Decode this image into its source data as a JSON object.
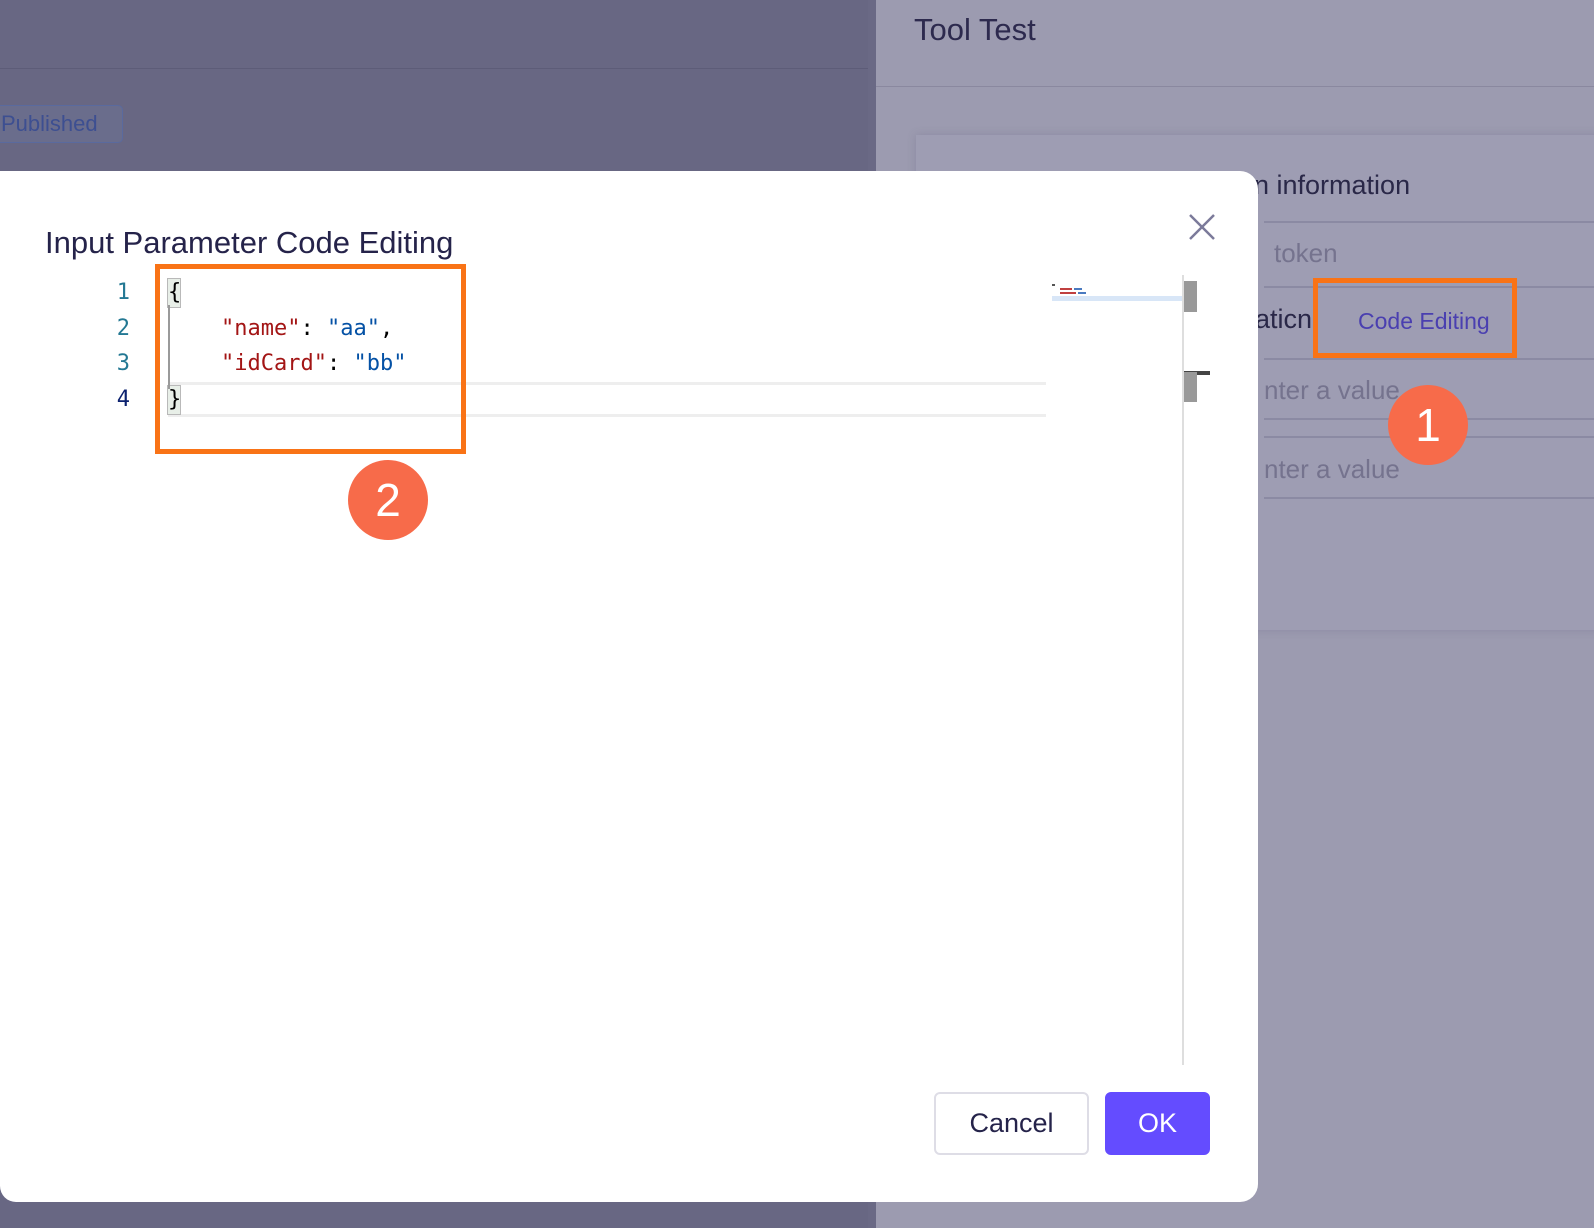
{
  "background": {
    "status_badge": "Published",
    "drawer": {
      "title": "Tool Test",
      "section_heading_partial": "n information",
      "token_field_partial": "token",
      "config_label_partial": "ratic",
      "config_label_tail": "n",
      "code_editing_link": "Code Editing",
      "value_field_1_placeholder_partial": "nter a value",
      "value_field_2_placeholder_partial": "nter a value"
    }
  },
  "annotations": {
    "step_1": "1",
    "step_2": "2",
    "highlight_color": "#f97316",
    "badge_color": "#f76b4a"
  },
  "modal": {
    "title": "Input Parameter Code Editing",
    "editor": {
      "language": "json",
      "line_numbers": [
        "1",
        "2",
        "3",
        "4"
      ],
      "active_line": 4,
      "lines": [
        {
          "indent": "",
          "tokens": [
            {
              "t": "{",
              "k": "bracket"
            }
          ]
        },
        {
          "indent": "    ",
          "tokens": [
            {
              "t": "\"name\"",
              "k": "key"
            },
            {
              "t": ": ",
              "k": "punc"
            },
            {
              "t": "\"aa\"",
              "k": "str"
            },
            {
              "t": ",",
              "k": "punc"
            }
          ]
        },
        {
          "indent": "    ",
          "tokens": [
            {
              "t": "\"idCard\"",
              "k": "key"
            },
            {
              "t": ": ",
              "k": "punc"
            },
            {
              "t": "\"bb\"",
              "k": "str"
            }
          ]
        },
        {
          "indent": "",
          "tokens": [
            {
              "t": "}",
              "k": "bracket"
            }
          ]
        }
      ]
    },
    "buttons": {
      "cancel": "Cancel",
      "ok": "OK"
    },
    "colors": {
      "primary": "#644cff",
      "title_text": "#25234a"
    }
  }
}
